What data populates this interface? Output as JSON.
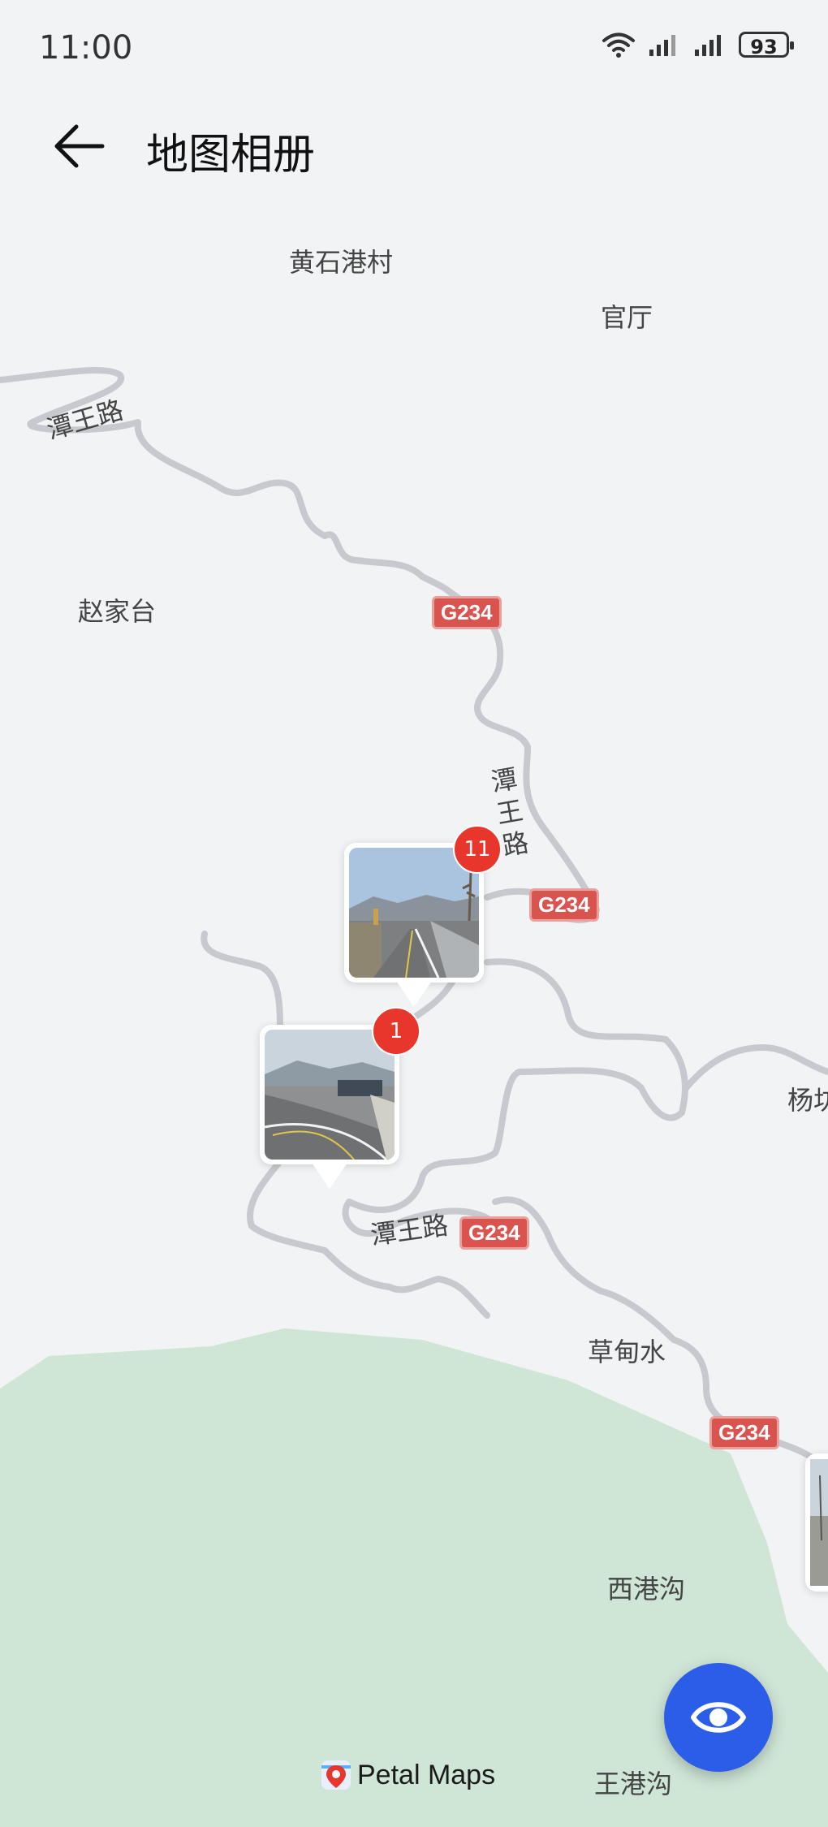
{
  "status_bar": {
    "time": "11:00",
    "battery": "93"
  },
  "header": {
    "title": "地图相册",
    "back_icon": "back-arrow-icon"
  },
  "map": {
    "places": [
      "黄石港村",
      "官厅",
      "赵家台",
      "杨坊",
      "草甸水",
      "西港沟",
      "王港沟"
    ],
    "road_labels": [
      "潭王路",
      "潭王路",
      "潭王路"
    ],
    "route_shields": [
      "G234",
      "G234",
      "G234",
      "G234"
    ],
    "colors": {
      "background": "#f2f3f5",
      "road": "#c7c9ce",
      "green": "#cfe6d6",
      "shield": "#d9534f",
      "badge": "#e8362d",
      "fab": "#2b5de9"
    }
  },
  "pins": [
    {
      "count": "11",
      "photo": "road-photo"
    },
    {
      "count": "1",
      "photo": "road-photo"
    }
  ],
  "fab": {
    "icon": "eye-icon"
  },
  "attribution": {
    "text": "Petal Maps",
    "icon": "petal-maps-logo-icon"
  }
}
